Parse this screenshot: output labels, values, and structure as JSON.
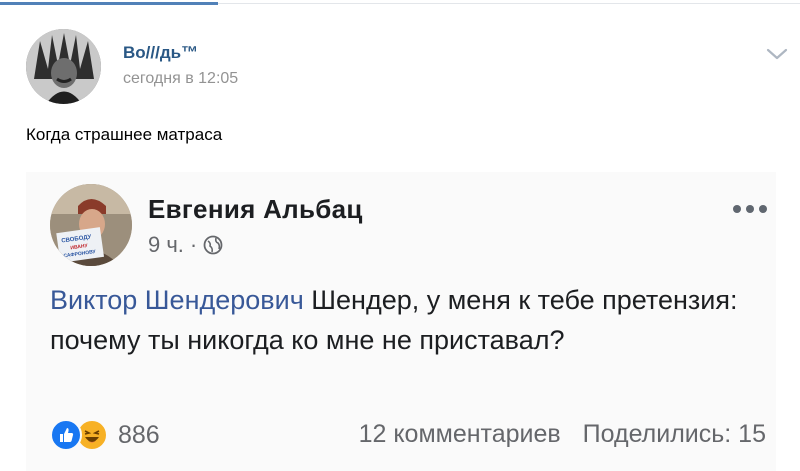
{
  "post": {
    "author": "Во///дь™",
    "time": "сегодня в 12:05",
    "text": "Когда страшнее матраса"
  },
  "screenshot": {
    "name": "Евгения Альбац",
    "time": "9 ч.",
    "separator": "·",
    "mention": "Виктор Шендерович",
    "body": " Шендер, у меня к тебе претензия: почему ты никогда ко мне не приставал?",
    "reactions_count": "886",
    "comments": "12 комментариев",
    "shares": "Поделились: 15",
    "avatar_caption_lines": [
      "СВОБОДУ",
      "ИВАНУ",
      "САФРОНОВУ"
    ]
  },
  "colors": {
    "accent": "#5181b8",
    "author_link": "#2a5885",
    "fb_link": "#385898",
    "muted": "#65676b"
  },
  "icons": {
    "menu": "chevron-down-icon",
    "more": "more-dots-icon",
    "privacy": "globe-icon",
    "reaction_1": "like-icon",
    "reaction_2": "haha-icon"
  }
}
